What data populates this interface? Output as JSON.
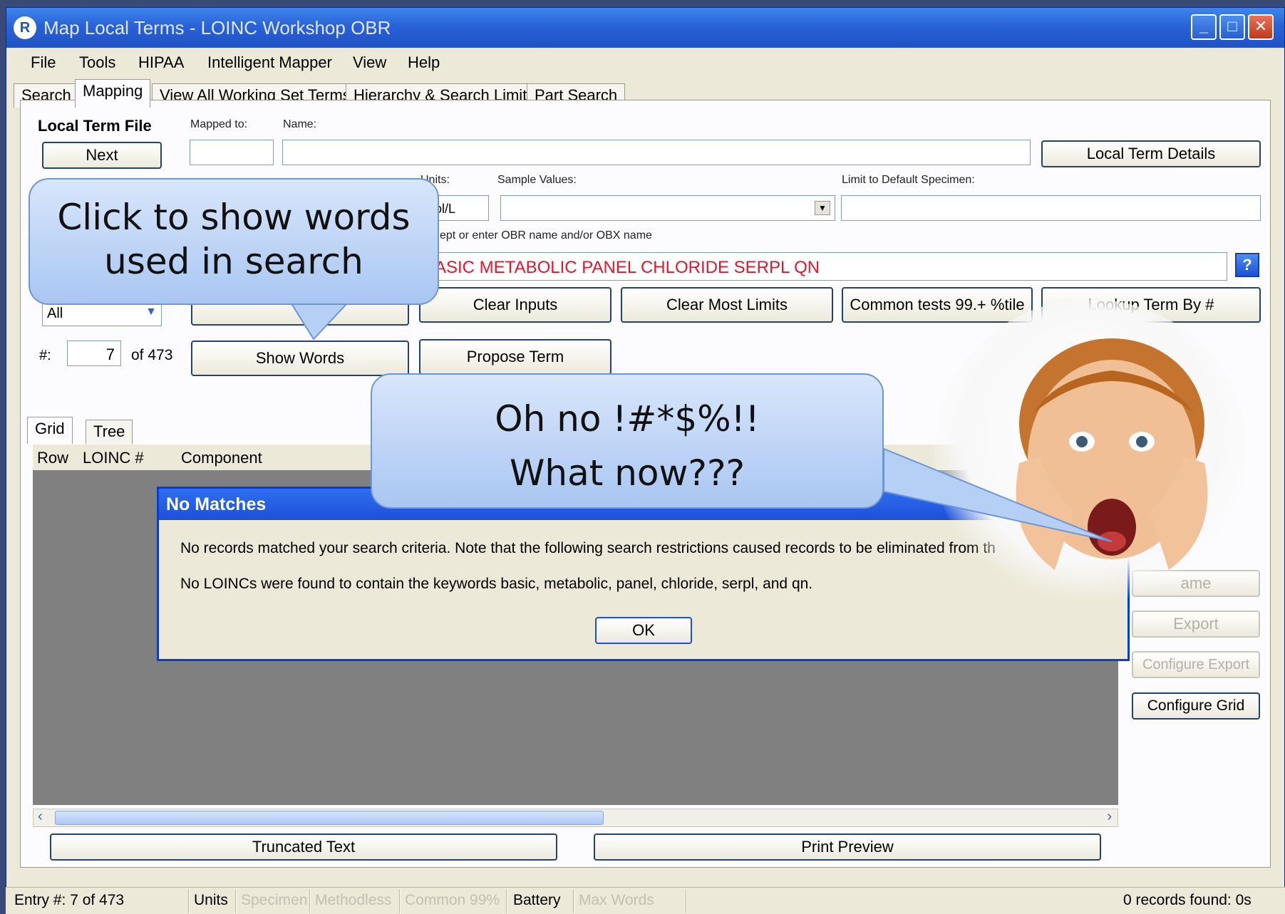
{
  "window": {
    "title": "Map Local Terms - LOINC Workshop OBR"
  },
  "menu": [
    "File",
    "Tools",
    "HIPAA",
    "Intelligent Mapper",
    "View",
    "Help"
  ],
  "tabs": [
    "Search",
    "Mapping",
    "View All Working Set Terms",
    "Hierarchy & Search Limits",
    "Part Search"
  ],
  "active_tab": "Mapping",
  "mapping": {
    "local_term_file_label": "Local Term File",
    "next_button": "Next",
    "mapped_to_label": "Mapped to:",
    "name_label": "Name:",
    "local_term_details_button": "Local Term Details",
    "units_label": "Units:",
    "units_value": "mol/L",
    "sample_values_label": "Sample Values:",
    "limit_specimen_label": "Limit to Default Specimen:",
    "hint_text": "ept or enter OBR name and/or OBX name",
    "search_text": "ASIC METABOLIC PANEL CHLORIDE SERPL QN",
    "help_icon_glyph": "?",
    "filter_value": "All",
    "entry_label": "#:",
    "entry_value": "7",
    "entry_of": "of 473",
    "clear_inputs_button": "Clear Inputs",
    "clear_most_limits_button": "Clear Most Limits",
    "common_tests_button": "Common tests 99.+ %tile",
    "lookup_term_button": "Lookup Term By #",
    "show_words_button": "Show Words",
    "propose_term_button": "Propose Term"
  },
  "grid": {
    "tabs": [
      "Grid",
      "Tree"
    ],
    "columns": [
      "Row",
      "LOINC #",
      "Component"
    ],
    "truncated_text_button": "Truncated Text",
    "print_preview_button": "Print Preview"
  },
  "side_buttons": {
    "partial_button": "ame",
    "export_button": "Export",
    "configure_export_button": "Configure Export",
    "configure_grid_button": "Configure Grid"
  },
  "dialog": {
    "title": "No Matches",
    "message_line1": "No records matched your search criteria. Note that the following search restrictions caused records to be eliminated from th",
    "message_line2": "No LOINCs were found to contain the keywords basic, metabolic, panel, chloride, serpl, and qn.",
    "ok_button": "OK"
  },
  "statusbar": {
    "entry": "Entry #: 7 of 473",
    "units": "Units",
    "specimen": "Specimen",
    "methodless": "Methodless",
    "common": "Common 99%",
    "battery": "Battery",
    "max_words": "Max Words",
    "records": "0 records found: 0s"
  },
  "callouts": {
    "show_words_line1": "Click to show words",
    "show_words_line2": "used in search",
    "oh_no_line1": "Oh no !#*$%!!",
    "oh_no_line2": "What now???"
  },
  "colors": {
    "title_bar": "#2a62d8",
    "search_text": "#e8142c",
    "callout_fill": "#c2d7f7",
    "grid_body": "#808080"
  }
}
